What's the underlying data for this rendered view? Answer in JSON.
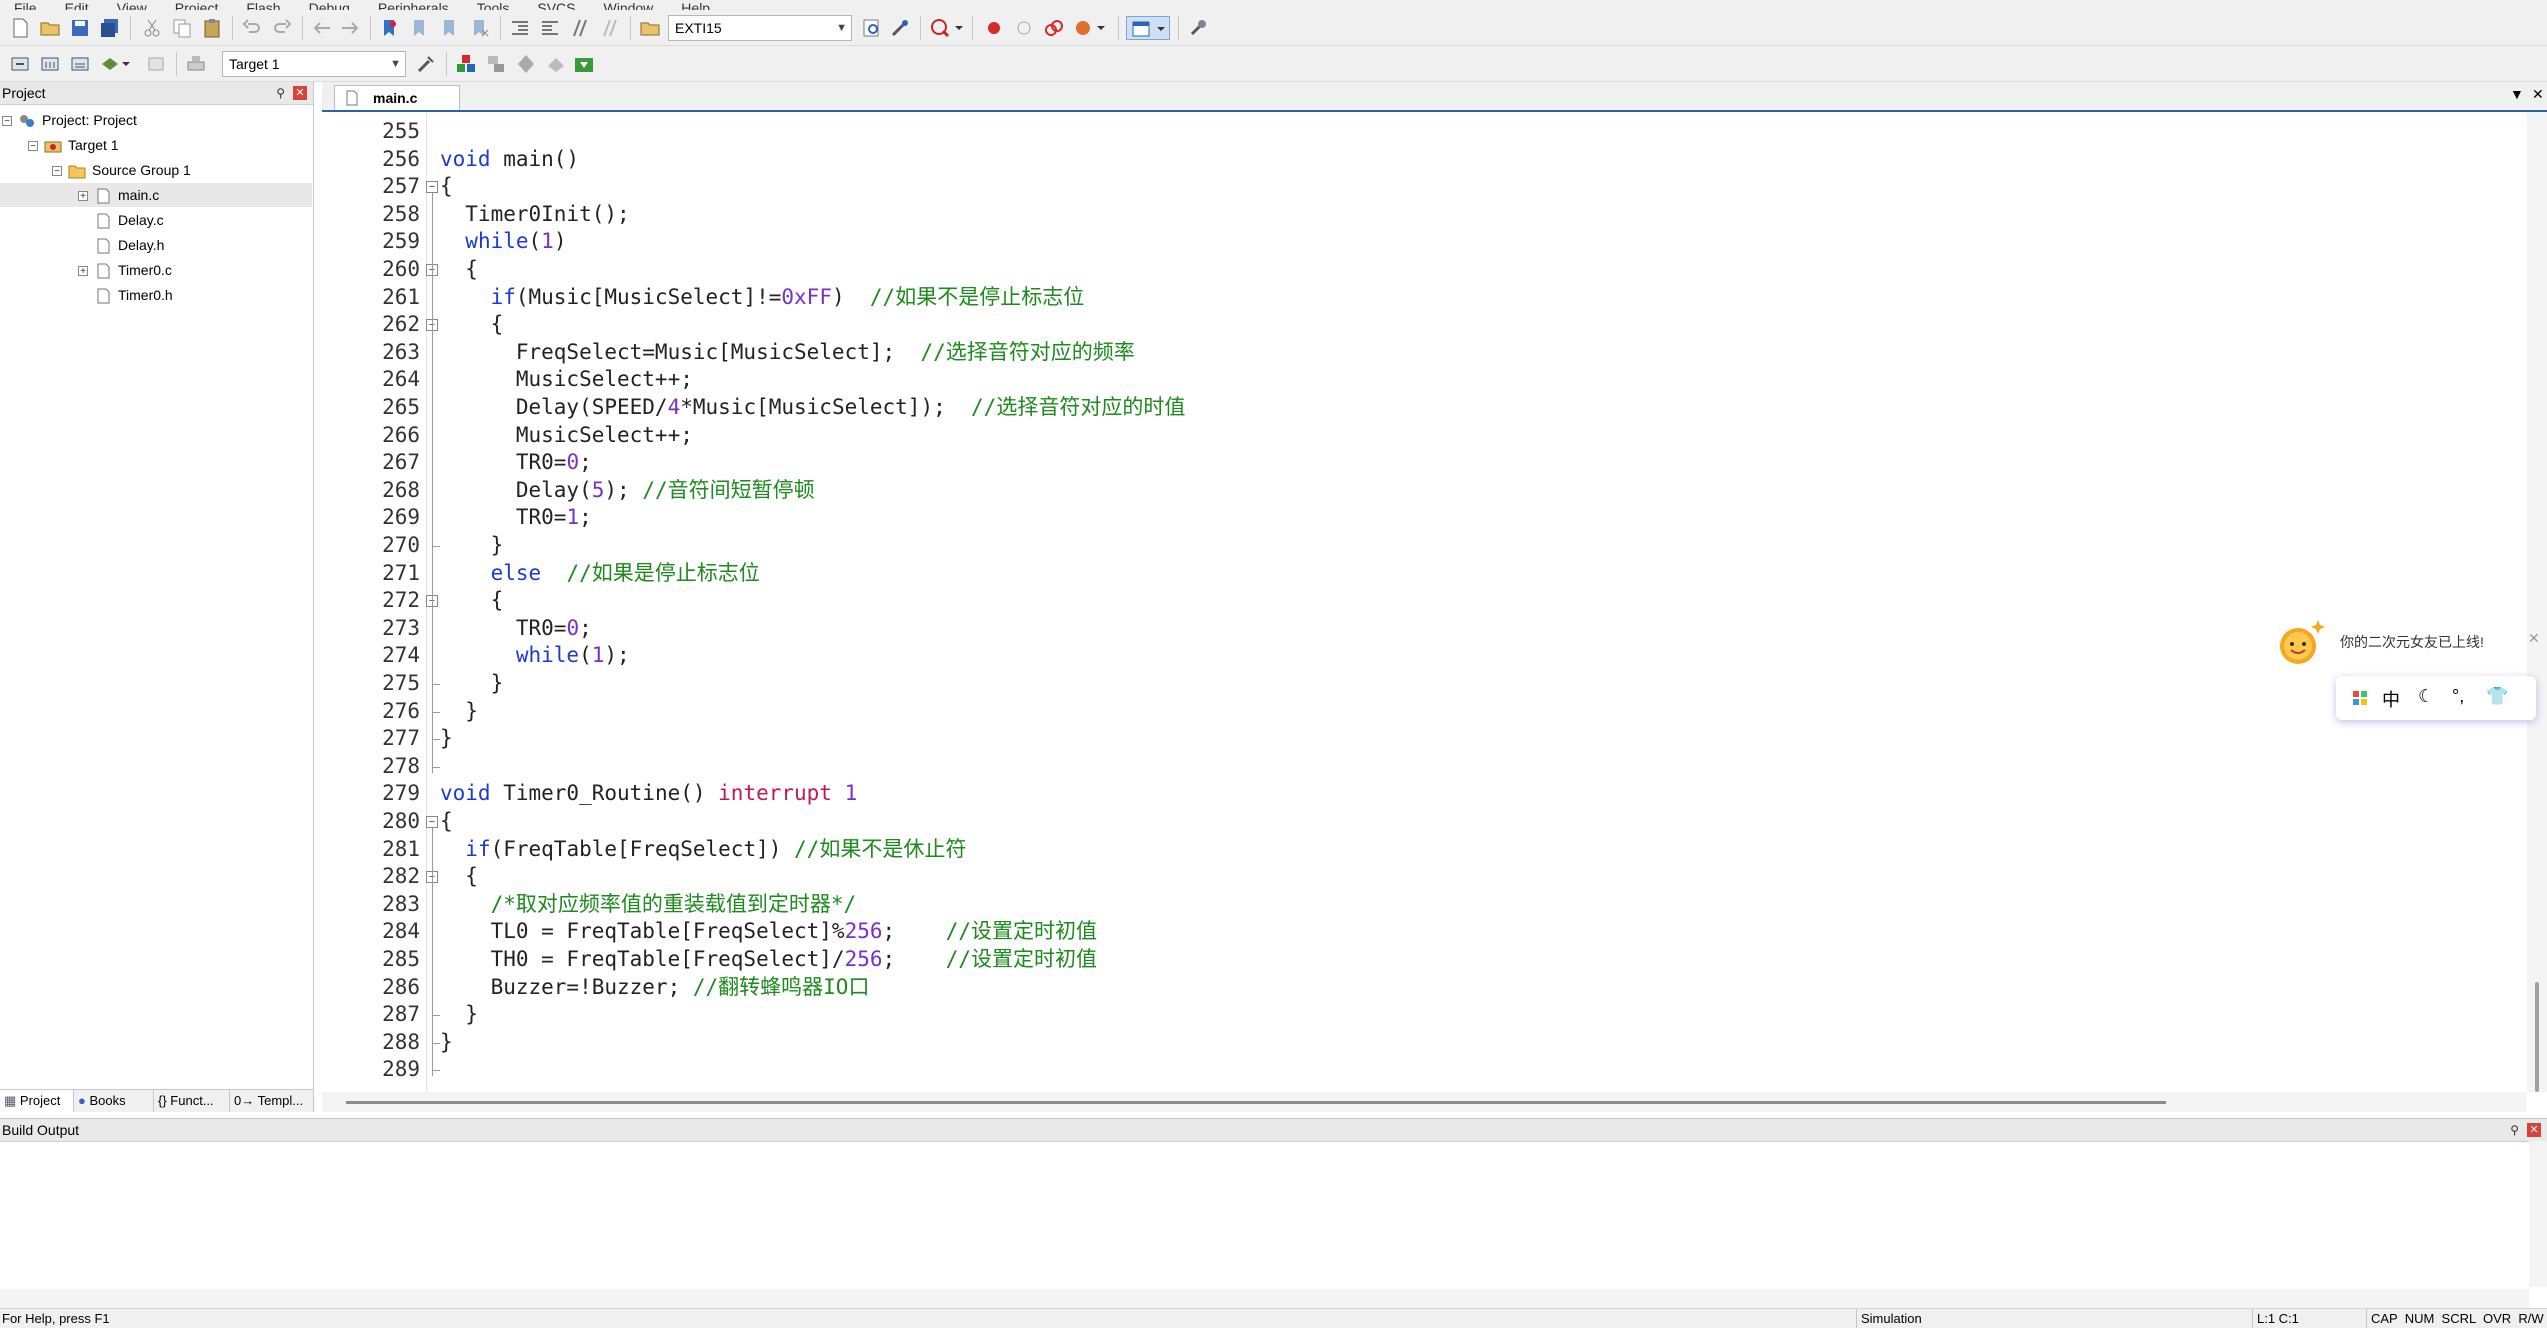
{
  "menu": [
    "File",
    "Edit",
    "View",
    "Project",
    "Flash",
    "Debug",
    "Peripherals",
    "Tools",
    "SVCS",
    "Window",
    "Help"
  ],
  "toolbar1": {
    "find_combo": "EXTI15"
  },
  "toolbar2": {
    "target_combo": "Target 1"
  },
  "project_panel": {
    "title": "Project",
    "tree": [
      {
        "label": "Project: Project",
        "level": 0,
        "expander": "−",
        "icon": "project-icon"
      },
      {
        "label": "Target 1",
        "level": 1,
        "expander": "−",
        "icon": "target-icon"
      },
      {
        "label": "Source Group 1",
        "level": 2,
        "expander": "−",
        "icon": "folder-icon"
      },
      {
        "label": "main.c",
        "level": 3,
        "expander": "+",
        "icon": "file-icon",
        "selected": true
      },
      {
        "label": "Delay.c",
        "level": 3,
        "expander": "",
        "icon": "file-icon"
      },
      {
        "label": "Delay.h",
        "level": 3,
        "expander": "",
        "icon": "file-icon"
      },
      {
        "label": "Timer0.c",
        "level": 3,
        "expander": "+",
        "icon": "file-icon"
      },
      {
        "label": "Timer0.h",
        "level": 3,
        "expander": "",
        "icon": "file-icon"
      }
    ],
    "tabs": [
      "Project",
      "Books",
      "{} Funct...",
      "0→ Templ..."
    ]
  },
  "editor": {
    "tab": "main.c",
    "lines": [
      {
        "n": "255",
        "t": ""
      },
      {
        "n": "256",
        "t": "<span class=\"kw\">void</span> main()"
      },
      {
        "n": "257",
        "t": "{"
      },
      {
        "n": "258",
        "t": "  Timer0Init();"
      },
      {
        "n": "259",
        "t": "  <span class=\"kw\">while</span>(<span class=\"num\">1</span>)"
      },
      {
        "n": "260",
        "t": "  {"
      },
      {
        "n": "261",
        "t": "    <span class=\"kw\">if</span>(Music[MusicSelect]!=<span class=\"num\">0xFF</span>)  <span class=\"cm\">//如果不是停止标志位</span>"
      },
      {
        "n": "262",
        "t": "    {"
      },
      {
        "n": "263",
        "t": "      FreqSelect=Music[MusicSelect];  <span class=\"cm\">//选择音符对应的频率</span>"
      },
      {
        "n": "264",
        "t": "      MusicSelect++;"
      },
      {
        "n": "265",
        "t": "      Delay(SPEED/<span class=\"num\">4</span>*Music[MusicSelect]);  <span class=\"cm\">//选择音符对应的时值</span>"
      },
      {
        "n": "266",
        "t": "      MusicSelect++;"
      },
      {
        "n": "267",
        "t": "      TR0=<span class=\"num\">0</span>;"
      },
      {
        "n": "268",
        "t": "      Delay(<span class=\"num\">5</span>); <span class=\"cm\">//音符间短暂停顿</span>"
      },
      {
        "n": "269",
        "t": "      TR0=<span class=\"num\">1</span>;"
      },
      {
        "n": "270",
        "t": "    }"
      },
      {
        "n": "271",
        "t": "    <span class=\"kw\">else</span>  <span class=\"cm\">//如果是停止标志位</span>"
      },
      {
        "n": "272",
        "t": "    {"
      },
      {
        "n": "273",
        "t": "      TR0=<span class=\"num\">0</span>;"
      },
      {
        "n": "274",
        "t": "      <span class=\"kw\">while</span>(<span class=\"num\">1</span>);"
      },
      {
        "n": "275",
        "t": "    }"
      },
      {
        "n": "276",
        "t": "  }"
      },
      {
        "n": "277",
        "t": "}"
      },
      {
        "n": "278",
        "t": ""
      },
      {
        "n": "279",
        "t": "<span class=\"kw\">void</span> Timer0_Routine() <span class=\"intr\">interrupt</span> <span class=\"num\">1</span>"
      },
      {
        "n": "280",
        "t": "{"
      },
      {
        "n": "281",
        "t": "  <span class=\"kw\">if</span>(FreqTable[FreqSelect]) <span class=\"cm\">//如果不是休止符</span>"
      },
      {
        "n": "282",
        "t": "  {"
      },
      {
        "n": "283",
        "t": "    <span class=\"cm\">/*取对应频率值的重装载值到定时器*/</span>"
      },
      {
        "n": "284",
        "t": "    TL0 = FreqTable[FreqSelect]%<span class=\"num\">256</span>;    <span class=\"cm\">//设置定时初值</span>"
      },
      {
        "n": "285",
        "t": "    TH0 = FreqTable[FreqSelect]/<span class=\"num\">256</span>;    <span class=\"cm\">//设置定时初值</span>"
      },
      {
        "n": "286",
        "t": "    Buzzer=!Buzzer; <span class=\"cm\">//翻转蜂鸣器IO口</span>"
      },
      {
        "n": "287",
        "t": "  }"
      },
      {
        "n": "288",
        "t": "}"
      },
      {
        "n": "289",
        "t": ""
      }
    ]
  },
  "build_output": {
    "title": "Build Output"
  },
  "status": {
    "help": "For Help, press F1",
    "mode": "Simulation",
    "position": "L:1 C:1",
    "indicators": "CAP  NUM  SCRL  OVR  R/W"
  },
  "ime": {
    "message": "你的二次元女友已上线!",
    "keys": [
      "中",
      "☾",
      "°,",
      "👕"
    ]
  }
}
